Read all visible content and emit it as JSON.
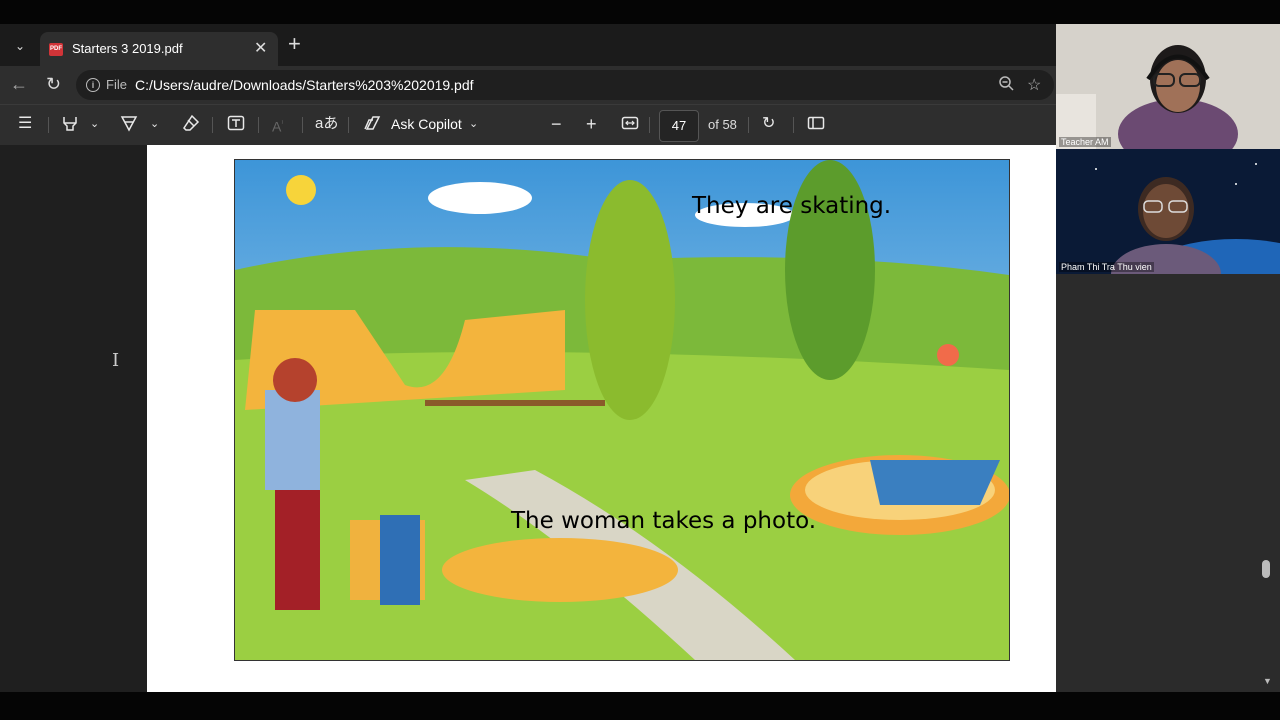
{
  "tab": {
    "title": "Starters 3 2019.pdf",
    "icon_text": "PDF",
    "close": "✕",
    "new_tab": "+"
  },
  "address": {
    "scheme_label": "File",
    "url": "C:/Users/audre/Downloads/Starters%203%202019.pdf"
  },
  "pdf_toolbar": {
    "copilot_label": "Ask Copilot",
    "page_current": "47",
    "page_total_label": "of 58"
  },
  "page": {
    "caption_skating": "They are skating.",
    "caption_photo": "The woman takes a photo."
  },
  "participants": [
    {
      "name": "Teacher AM"
    },
    {
      "name": "Pham Thi Tra Thu vien"
    }
  ],
  "colors": {
    "accent_red": "#e65a4d",
    "pdf_icon": "#d13438",
    "tab_bg": "#2e2e2e"
  }
}
